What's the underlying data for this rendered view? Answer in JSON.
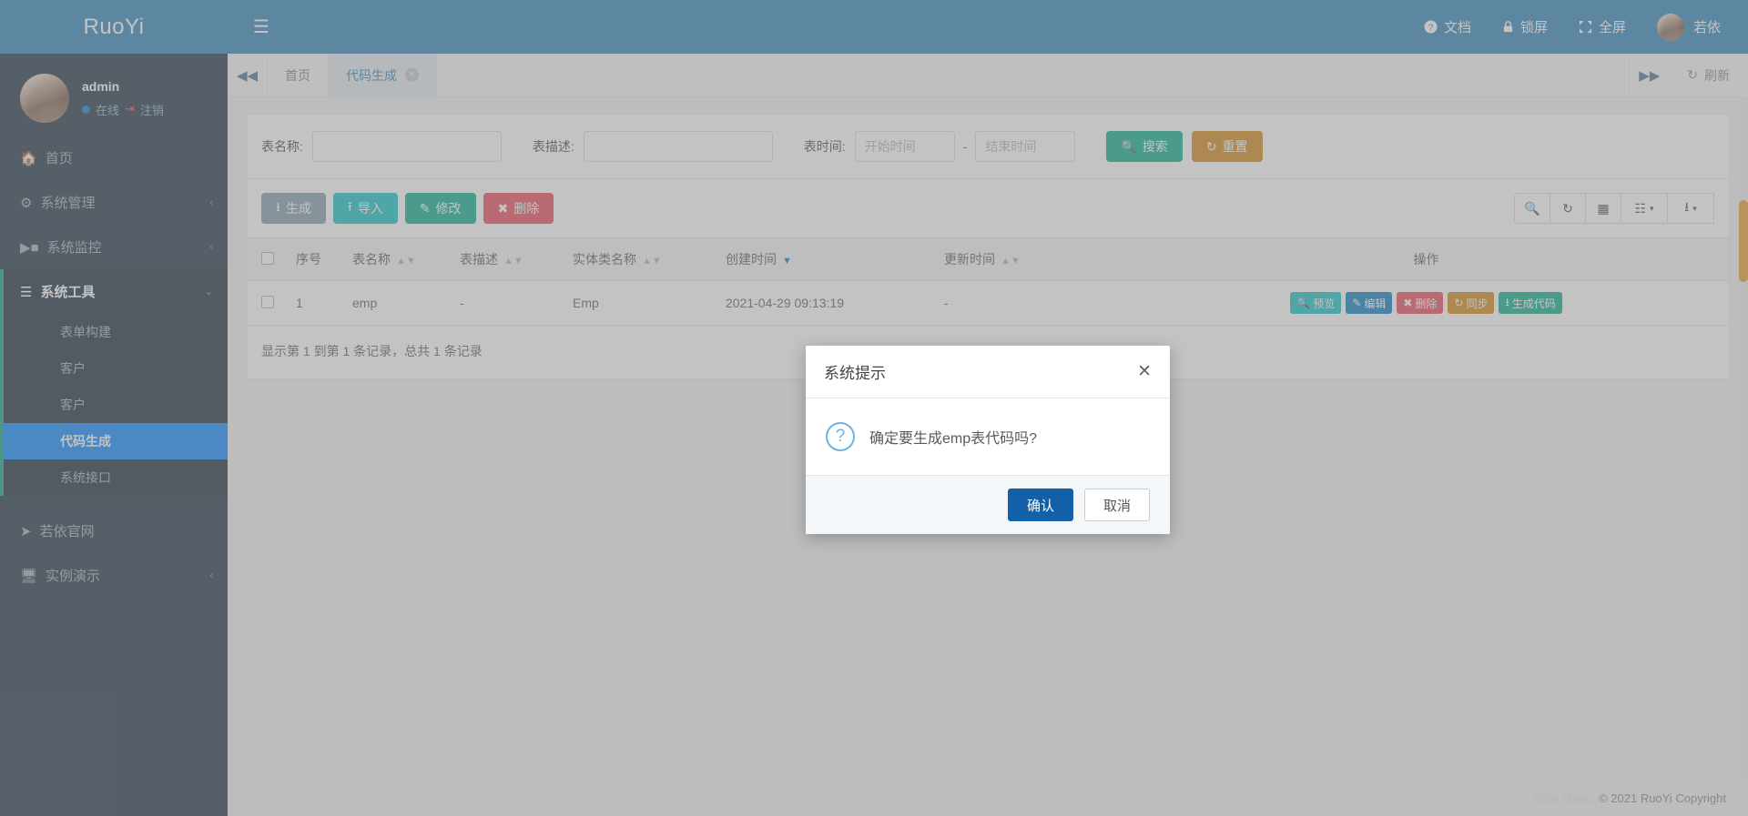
{
  "brand": {
    "name": "RuoYi"
  },
  "profile": {
    "name": "admin",
    "status": "在线",
    "logout": "注销"
  },
  "sidebar": {
    "items": [
      {
        "label": "首页",
        "icon": "home-icon",
        "caret": ""
      },
      {
        "label": "系统管理",
        "icon": "gear-icon",
        "caret": "‹"
      },
      {
        "label": "系统监控",
        "icon": "video-icon",
        "caret": "‹"
      },
      {
        "label": "系统工具",
        "icon": "list-icon",
        "caret": "⌄"
      }
    ],
    "tools_submenu": [
      {
        "label": "表单构建",
        "active": false
      },
      {
        "label": "客户",
        "active": false
      },
      {
        "label": "客户",
        "active": false
      },
      {
        "label": "代码生成",
        "active": true
      },
      {
        "label": "系统接口",
        "active": false
      }
    ],
    "extra": [
      {
        "label": "若依官网",
        "icon": "send-icon",
        "caret": ""
      },
      {
        "label": "实例演示",
        "icon": "monitor-icon",
        "caret": "‹"
      }
    ]
  },
  "navbar": {
    "toggle": "☰",
    "links": [
      {
        "label": "文档",
        "icon": "help-circle-icon"
      },
      {
        "label": "锁屏",
        "icon": "lock-icon"
      },
      {
        "label": "全屏",
        "icon": "fullscreen-icon"
      }
    ],
    "user": "若依"
  },
  "tabs": {
    "left_arrow": "◀◀",
    "right_arrow": "▶▶",
    "items": [
      {
        "label": "首页",
        "active": false,
        "closable": false
      },
      {
        "label": "代码生成",
        "active": true,
        "closable": true
      }
    ],
    "close_glyph": "✕",
    "refresh": "刷新"
  },
  "search": {
    "table_name_label": "表名称:",
    "table_name_value": "",
    "table_desc_label": "表描述:",
    "table_desc_value": "",
    "table_time_label": "表时间:",
    "start_placeholder": "开始时间",
    "end_placeholder": "结束时间",
    "separator": "-",
    "search_button": "搜索",
    "reset_button": "重置"
  },
  "toolbar": {
    "generate": "生成",
    "import": "导入",
    "edit": "修改",
    "delete": "删除",
    "icons": [
      {
        "name": "search-icon",
        "glyph": "🔍"
      },
      {
        "name": "refresh-icon",
        "glyph": "⟳"
      },
      {
        "name": "columns-icon",
        "glyph": "▤"
      },
      {
        "name": "grid-icon",
        "glyph": "⠿"
      },
      {
        "name": "export-icon",
        "glyph": "⬇"
      }
    ]
  },
  "table": {
    "columns": [
      {
        "label": "序号",
        "sortable": false,
        "sorted": false
      },
      {
        "label": "表名称",
        "sortable": true,
        "sorted": false
      },
      {
        "label": "表描述",
        "sortable": true,
        "sorted": false
      },
      {
        "label": "实体类名称",
        "sortable": true,
        "sorted": false
      },
      {
        "label": "创建时间",
        "sortable": true,
        "sorted": true
      },
      {
        "label": "更新时间",
        "sortable": true,
        "sorted": false
      },
      {
        "label": "操作",
        "sortable": false,
        "sorted": false
      }
    ],
    "rows": [
      {
        "index": "1",
        "table_name": "emp",
        "table_desc": "-",
        "entity_class": "Emp",
        "create_time": "2021-04-29 09:13:19",
        "update_time": "-"
      }
    ],
    "row_actions": [
      {
        "label": "预览",
        "style": "info",
        "icon": "search-icon"
      },
      {
        "label": "编辑",
        "style": "primary",
        "icon": "pencil-icon"
      },
      {
        "label": "删除",
        "style": "danger",
        "icon": "close-icon"
      },
      {
        "label": "同步",
        "style": "warning",
        "icon": "refresh-icon"
      },
      {
        "label": "生成代码",
        "style": "success",
        "icon": "download-icon"
      }
    ],
    "pager_text": "显示第 1 到第 1 条记录，总共 1 条记录"
  },
  "modal": {
    "title": "系统提示",
    "close": "✕",
    "icon": "question-icon",
    "message": "确定要生成emp表代码吗?",
    "confirm": "确认",
    "cancel": "取消"
  },
  "footer": {
    "ghost": "https://blog.",
    "text": "© 2021 RuoYi Copyright"
  },
  "colors": {
    "brand": "#3c8dbc",
    "sidebar": "#2f4050",
    "active": "#1890ff",
    "success": "#1ab394",
    "warning": "#d59025",
    "danger": "#ed5565",
    "primary": "#1c84c6",
    "modal_confirm": "#1260a8",
    "scrollbar": "#e8a33d"
  }
}
